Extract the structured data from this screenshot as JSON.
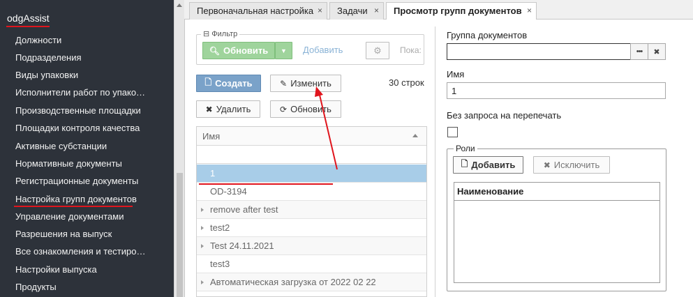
{
  "sidebar": {
    "title": "odgAssist",
    "items": [
      "Должности",
      "Подразделения",
      "Виды упаковки",
      "Исполнители работ по упако…",
      "Производственные площадки",
      "Площадки контроля качества",
      "Активные субстанции",
      "Нормативные документы",
      "Регистрационные документы",
      "Настройка групп документов",
      "Управление документами",
      "Разрешения на выпуск",
      "Все ознакомления и тестиро…",
      "Настройки выпуска",
      "Продукты"
    ]
  },
  "tabs": [
    {
      "label": "Первоначальная настройка",
      "close": "×"
    },
    {
      "label": "Задачи",
      "close": "×"
    },
    {
      "label": "Просмотр групп документов",
      "close": "×"
    }
  ],
  "filter": {
    "legend": "Фильтр",
    "refresh_label": "Обновить",
    "add_label": "Добавить",
    "show_label": "Пока:"
  },
  "toolbar": {
    "create_label": "Создать",
    "edit_label": "Изменить",
    "delete_label": "Удалить",
    "refresh_label": "Обновить",
    "rows_count": "30 строк"
  },
  "grid": {
    "column": "Имя",
    "rows": [
      {
        "name": "1",
        "expandable": false
      },
      {
        "name": "OD-3194",
        "expandable": false
      },
      {
        "name": "remove after test",
        "expandable": true
      },
      {
        "name": "test2",
        "expandable": true
      },
      {
        "name": "Test 24.11.2021",
        "expandable": true
      },
      {
        "name": "test3",
        "expandable": false
      },
      {
        "name": "Автоматическая загрузка от 2022 02 22",
        "expandable": true
      }
    ]
  },
  "form": {
    "group_label": "Группа документов",
    "group_value": "",
    "browse_label": "•••",
    "clear_label": "✖",
    "name_label": "Имя",
    "name_value": "1",
    "no_reprint_label": "Без запроса на перепечать",
    "roles": {
      "legend": "Роли",
      "add_label": "Добавить",
      "exclude_label": "Исключить",
      "column": "Наименование"
    }
  },
  "colors": {
    "sidebar_bg": "#2d323a",
    "selected_row": "#a8cde8",
    "annotation_red": "#e0151d"
  }
}
